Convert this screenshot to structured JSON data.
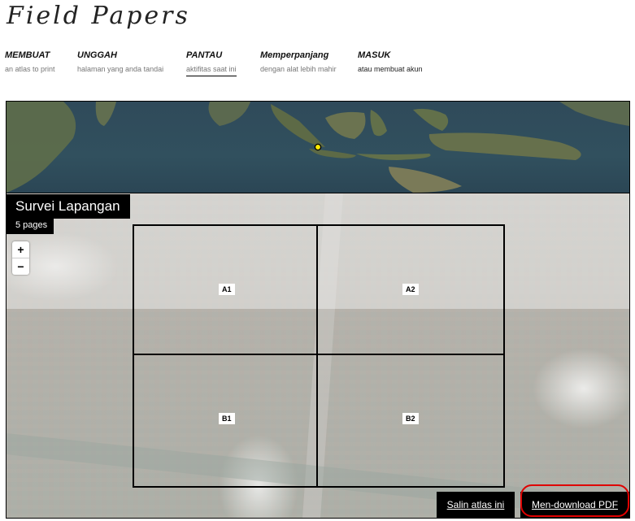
{
  "app": {
    "logo": "Field Papers"
  },
  "nav": [
    {
      "title": "MEMBUAT",
      "subtitle": "an atlas to print"
    },
    {
      "title": "UNGGAH",
      "subtitle": "halaman yang anda tandai"
    },
    {
      "title": "PANTAU",
      "subtitle": "aktifitas saat ini",
      "active": true
    },
    {
      "title": "Memperpanjang",
      "subtitle": "dengan alat lebih mahir"
    },
    {
      "title": "MASUK",
      "subtitle": "atau membuat akun"
    }
  ],
  "atlas": {
    "title": "Survei Lapangan",
    "pages": "5 pages"
  },
  "zoom": {
    "in": "+",
    "out": "−"
  },
  "grid": {
    "cells": [
      "A1",
      "A2",
      "B1",
      "B2"
    ]
  },
  "actions": {
    "copy_label": "Salin atlas ini",
    "download_label": "Men-download PDF"
  },
  "colors": {
    "annotation": "#e00000",
    "location_marker": "#ffeb00"
  }
}
